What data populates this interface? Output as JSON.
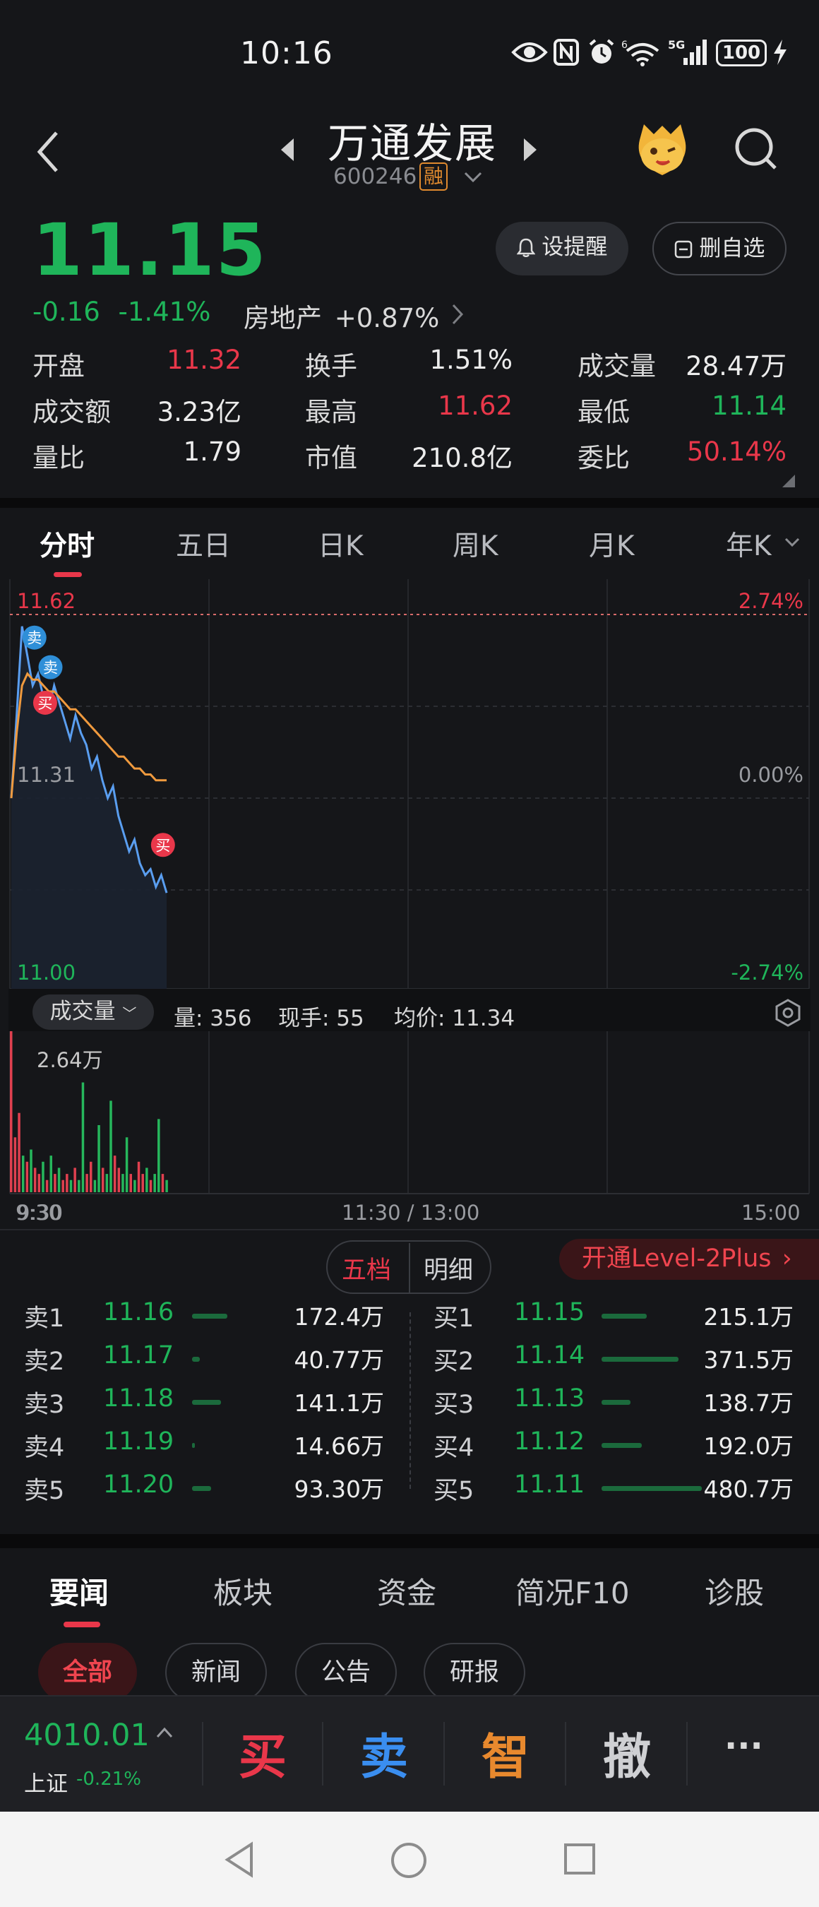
{
  "status_bar": {
    "time": "10:16",
    "battery": "100",
    "network": "5G",
    "wifi_badge": "6"
  },
  "header": {
    "stock_name": "万通发展",
    "stock_code": "600246",
    "rong_badge": "融"
  },
  "quote": {
    "price": "11.15",
    "change": "-0.16",
    "change_pct": "-1.41%",
    "sector_name": "房地产",
    "sector_change": "+0.87%",
    "alert_button": "设提醒",
    "watchlist_button": "删自选",
    "stats": [
      {
        "label": "开盘",
        "value": "11.32",
        "color": "red"
      },
      {
        "label": "换手",
        "value": "1.51%",
        "color": "white"
      },
      {
        "label": "成交量",
        "value": "28.47万",
        "color": "white"
      },
      {
        "label": "成交额",
        "value": "3.23亿",
        "color": "white"
      },
      {
        "label": "最高",
        "value": "11.62",
        "color": "red"
      },
      {
        "label": "最低",
        "value": "11.14",
        "color": "green"
      },
      {
        "label": "量比",
        "value": "1.79",
        "color": "white"
      },
      {
        "label": "市值",
        "value": "210.8亿",
        "color": "white"
      },
      {
        "label": "委比",
        "value": "50.14%",
        "color": "red"
      }
    ]
  },
  "chart_tabs": [
    "分时",
    "五日",
    "日K",
    "周K",
    "月K",
    "年K"
  ],
  "chart_data": {
    "type": "line",
    "title": "",
    "price_axis": {
      "top": "11.62",
      "mid": "11.31",
      "bottom": "11.00"
    },
    "pct_axis": {
      "top": "2.74%",
      "mid": "0.00%",
      "bottom": "-2.74%"
    },
    "ylim": [
      11.0,
      11.62
    ],
    "time_labels": [
      "9:30",
      "11:30 / 13:00",
      "15:00"
    ],
    "series": [],
    "price_series": [
      11.31,
      11.45,
      11.6,
      11.55,
      11.5,
      11.52,
      11.48,
      11.46,
      11.5,
      11.47,
      11.44,
      11.41,
      11.45,
      11.42,
      11.4,
      11.36,
      11.38,
      11.34,
      11.31,
      11.33,
      11.28,
      11.25,
      11.22,
      11.24,
      11.2,
      11.18,
      11.19,
      11.16,
      11.18,
      11.15
    ],
    "avg_series": [
      11.31,
      11.42,
      11.5,
      11.52,
      11.51,
      11.51,
      11.5,
      11.49,
      11.49,
      11.48,
      11.47,
      11.46,
      11.46,
      11.45,
      11.44,
      11.43,
      11.42,
      11.41,
      11.4,
      11.39,
      11.38,
      11.38,
      11.37,
      11.36,
      11.36,
      11.35,
      11.35,
      11.34,
      11.34,
      11.34
    ],
    "markers": [
      {
        "label": "卖",
        "index": 3,
        "value": 11.55,
        "color": "#2f8fd8"
      },
      {
        "label": "卖",
        "index": 6,
        "value": 11.5,
        "color": "#2f8fd8"
      },
      {
        "label": "买",
        "index": 5,
        "value": 11.44,
        "color": "#e9374a"
      },
      {
        "label": "买",
        "index": 27,
        "value": 11.2,
        "color": "#e9374a"
      }
    ],
    "volume": {
      "max_label": "2.64万",
      "bars": [
        2.64,
        0.9,
        1.3,
        0.6,
        0.5,
        0.7,
        0.4,
        0.3,
        0.5,
        0.2,
        0.6,
        0.3,
        0.4,
        0.2,
        0.3,
        0.2,
        0.4,
        0.2,
        1.8,
        0.3,
        0.5,
        0.2,
        1.1,
        0.4,
        0.3,
        1.5,
        0.6,
        0.4,
        0.3,
        0.9,
        0.3,
        0.2,
        0.5,
        0.3,
        0.4,
        0.2,
        0.3,
        1.2,
        0.3,
        0.2
      ],
      "bar_colors": [
        "r",
        "r",
        "r",
        "g",
        "r",
        "g",
        "r",
        "r",
        "g",
        "r",
        "g",
        "r",
        "g",
        "r",
        "r",
        "g",
        "r",
        "g",
        "g",
        "r",
        "r",
        "g",
        "g",
        "r",
        "g",
        "g",
        "r",
        "r",
        "g",
        "g",
        "r",
        "g",
        "r",
        "r",
        "g",
        "r",
        "g",
        "g",
        "r",
        "g"
      ]
    }
  },
  "volume_panel": {
    "dropdown_label": "成交量",
    "qty_label": "量: 356",
    "hand_label": "现手: 55",
    "avg_label": "均价: 11.34"
  },
  "orderbook": {
    "tabs": [
      "五档",
      "明细"
    ],
    "level2_label": "开通Level-2Plus",
    "sell": [
      {
        "label": "卖1",
        "price": "11.16",
        "volume": "172.4万",
        "ratio": 0.36
      },
      {
        "label": "卖2",
        "price": "11.17",
        "volume": "40.77万",
        "ratio": 0.08
      },
      {
        "label": "卖3",
        "price": "11.18",
        "volume": "141.1万",
        "ratio": 0.29
      },
      {
        "label": "卖4",
        "price": "11.19",
        "volume": "14.66万",
        "ratio": 0.03
      },
      {
        "label": "卖5",
        "price": "11.20",
        "volume": "93.30万",
        "ratio": 0.19
      }
    ],
    "buy": [
      {
        "label": "买1",
        "price": "11.15",
        "volume": "215.1万",
        "ratio": 0.45
      },
      {
        "label": "买2",
        "price": "11.14",
        "volume": "371.5万",
        "ratio": 0.77
      },
      {
        "label": "买3",
        "price": "11.13",
        "volume": "138.7万",
        "ratio": 0.29
      },
      {
        "label": "买4",
        "price": "11.12",
        "volume": "192.0万",
        "ratio": 0.4
      },
      {
        "label": "买5",
        "price": "11.11",
        "volume": "480.7万",
        "ratio": 1.0
      }
    ]
  },
  "news_tabs": [
    "要闻",
    "板块",
    "资金",
    "简况F10",
    "诊股"
  ],
  "news_chips": [
    "全部",
    "新闻",
    "公告",
    "研报"
  ],
  "bottom_bar": {
    "index_value": "4010.01",
    "index_name": "上证",
    "index_change": "-0.21%",
    "buy": "买",
    "sell": "卖",
    "smart": "智",
    "cancel": "撤",
    "more": "···"
  },
  "colors": {
    "red": "#e9374a",
    "green": "#1fb55a",
    "blue": "#2f8fd8",
    "orange": "#e8892e",
    "bg": "#151619"
  }
}
